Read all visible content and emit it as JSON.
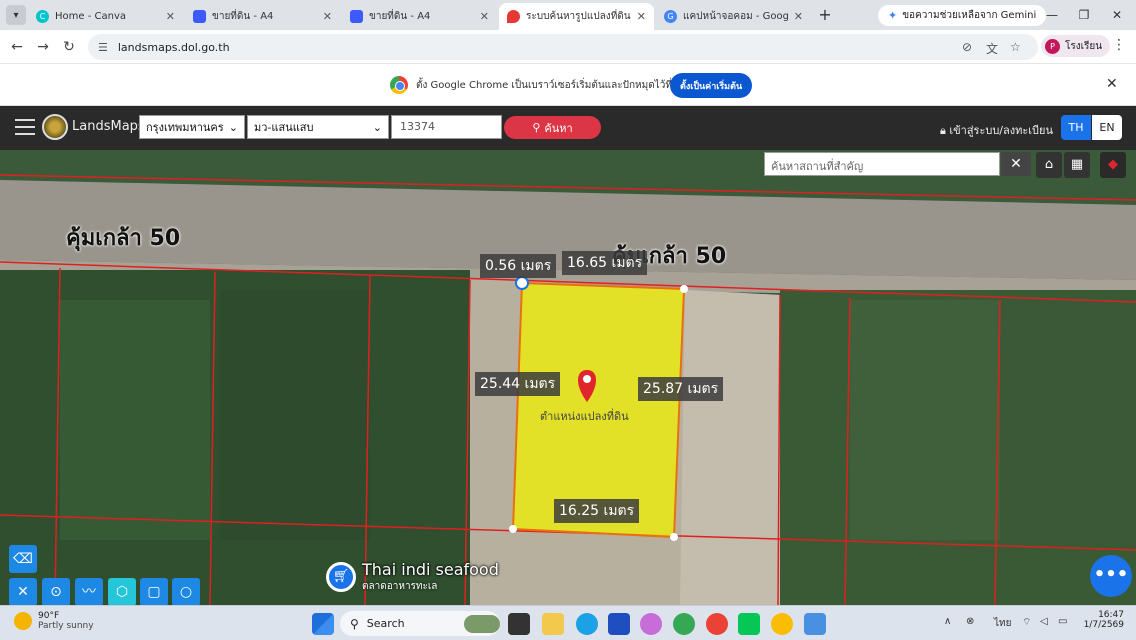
{
  "browser": {
    "tabs": [
      {
        "title": "Home - Canva",
        "color": "#00c4cc"
      },
      {
        "title": "ขายที่ดิน - A4",
        "color": "#3d5afe"
      },
      {
        "title": "ขายที่ดิน - A4",
        "color": "#3d5afe"
      },
      {
        "title": "ระบบค้นหารูปแปลงที่ดิน (Land",
        "color": "#e53935"
      },
      {
        "title": "แคปหน้าจอคอม - Google Se",
        "color": "#4285f4"
      }
    ],
    "gemini_label": "ขอความช่วยเหลือจาก Gemini",
    "url": "landsmaps.dol.go.th",
    "profile_initial": "P",
    "profile_label": "โรงเรียน"
  },
  "infobar": {
    "message": "ตั้ง Google Chrome เป็นเบราว์เซอร์เริ่มต้นและปักหมุดไว้ที่แถบงาน",
    "button": "ตั้งเป็นค่าเริ่มต้น"
  },
  "landsmaps": {
    "brand": "LandsMaps",
    "province": "กรุงเทพมหานคร",
    "district": "มว-แสนแสบ",
    "parcel_number": "13374",
    "search_button": "ค้นหา",
    "login": "เข้าสู่ระบบ/ลงทะเบียน",
    "lang_th": "TH",
    "lang_en": "EN",
    "place_search_placeholder": "ค้นหาสถานที่สำคัญ"
  },
  "map": {
    "road_name_1": "คุ้มเกล้า 50",
    "road_name_2": "คุ้มเกล้า 50",
    "measurements": {
      "m1": "0.56 เมตร",
      "m2": "16.65 เมตร",
      "m3": "25.44 เมตร",
      "m4": "25.87 เมตร",
      "m5": "16.25 เมตร"
    },
    "pin_label": "ตำแหน่งแปลงที่ดิน",
    "poi_name": "Thai indi seafood",
    "poi_sub": "ตลาดอาหารทะเล",
    "fab_label": "•••"
  },
  "taskbar": {
    "temp": "90°F",
    "weather": "Partly sunny",
    "search": "Search",
    "lang": "ไทย",
    "time": "16:47",
    "date": "1/7/2569"
  }
}
